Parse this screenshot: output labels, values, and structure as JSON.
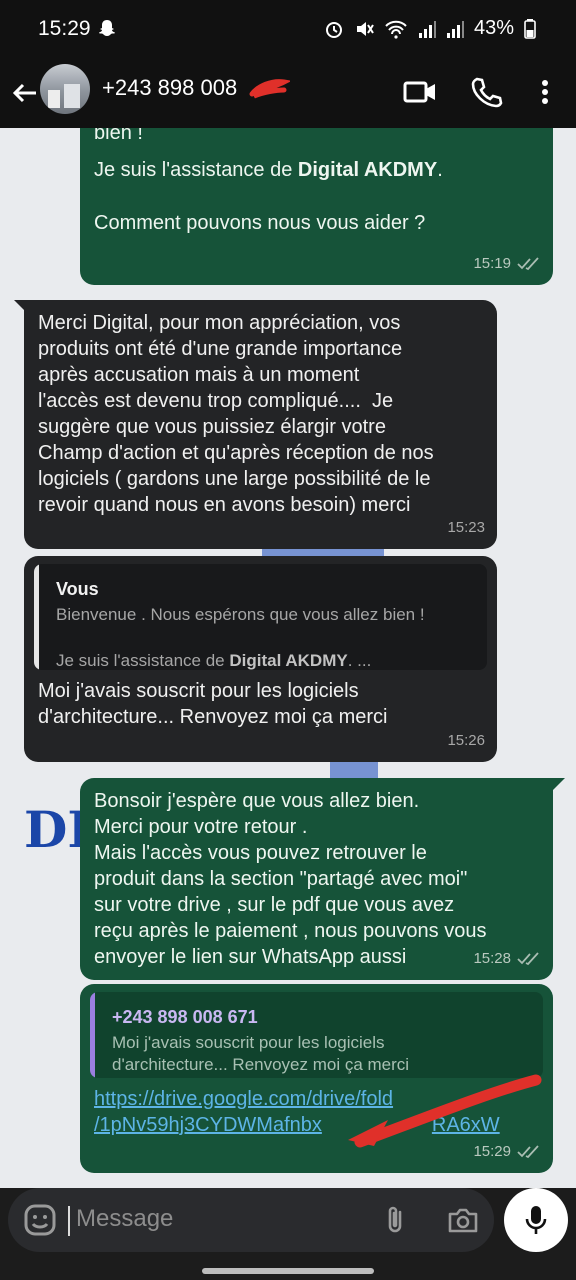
{
  "status_bar": {
    "time": "15:29",
    "battery": "43%"
  },
  "header": {
    "contact": "+243 898 008"
  },
  "messages": {
    "m1": {
      "text_top": "bien !",
      "text_middle_pre": "Je suis l'assistance de ",
      "brand": "Digital AKDMY",
      "text_middle_post": ".",
      "text_bottom": "Comment pouvons nous vous aider ?",
      "time": "15:19"
    },
    "m2": {
      "text": "Merci Digital, pour mon appréciation, vos\nproduits ont été d'une grande importance\naprès accusation mais à un moment\nl'accès est devenu trop compliqué....  Je\nsuggère que vous puissiez élargir votre\nChamp d'action et qu'après réception de nos\nlogiciels ( gardons une large possibilité de le\nrevoir quand nous en avons besoin) merci",
      "time": "15:23"
    },
    "m3": {
      "quote_author": "Vous",
      "quote_line1": "Bienvenue . Nous espérons que vous allez bien !",
      "quote_line2_pre": "Je suis l'assistance de ",
      "quote_line2_brand": "Digital AKDMY",
      "quote_line2_post": ". ...",
      "text": "Moi j'avais souscrit pour les logiciels\nd'architecture... Renvoyez moi ça merci",
      "time": "15:26"
    },
    "m4": {
      "text": "Bonsoir j'espère que vous allez bien.\nMerci pour votre retour .\nMais l'accès vous pouvez retrouver le\nproduit dans la section \"partagé avec moi\"\nsur votre drive , sur le pdf que vous avez\nreçu après le paiement , nous pouvons vous\nenvoyer le lien sur WhatsApp aussi",
      "time": "15:28"
    },
    "m5": {
      "quote_author": "+243 898 008 671",
      "quote_text": "Moi j'avais souscrit pour les logiciels\nd'architecture... Renvoyez moi ça merci",
      "link_line1": "https://drive.google.com/drive/fold",
      "link_line2": "/1pNv59hj3CYDWMafnbx",
      "link_line2_tail": "RA6xW",
      "time": "15:29"
    }
  },
  "composer": {
    "placeholder": "Message"
  },
  "background_watermark": {
    "letters": "DI"
  },
  "icons": {
    "back": "arrow-left-icon",
    "video": "video-camera-icon",
    "call": "phone-icon",
    "menu": "more-vertical-icon",
    "emoji": "emoji-icon",
    "attach": "paperclip-icon",
    "camera": "camera-icon",
    "mic": "microphone-icon",
    "read": "double-check-icon"
  },
  "colors": {
    "outgoing": "#165339",
    "incoming": "#232426",
    "link": "#5db4e6",
    "accent": "#9b7fe0"
  }
}
